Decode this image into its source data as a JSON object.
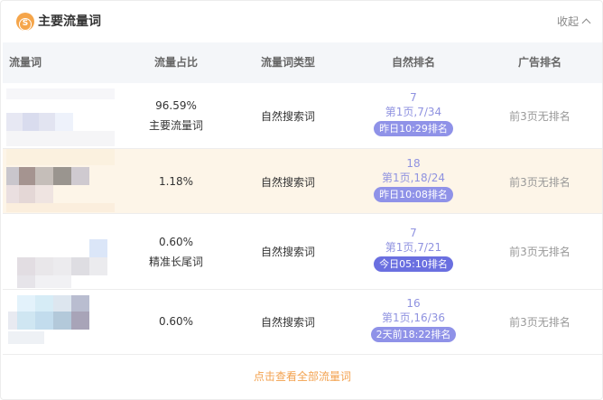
{
  "header": {
    "title": "主要流量词",
    "logo_icon": "s-coin-icon",
    "collapse_label": "收起"
  },
  "columns": [
    "流量词",
    "流量占比",
    "流量词类型",
    "自然排名",
    "广告排名"
  ],
  "rows": [
    {
      "share": "96.59%",
      "share_tag": "主要流量词",
      "type": "自然搜索词",
      "rank": "7",
      "rank_page": "第1页,7/34",
      "rank_time": "昨日10:29排名",
      "ad_rank": "前3页无排名",
      "highlight": false
    },
    {
      "share": "1.18%",
      "share_tag": "",
      "type": "自然搜索词",
      "rank": "18",
      "rank_page": "第1页,18/24",
      "rank_time": "昨日10:08排名",
      "ad_rank": "前3页无排名",
      "highlight": true
    },
    {
      "share": "0.60%",
      "share_tag": "精准长尾词",
      "type": "自然搜索词",
      "rank": "7",
      "rank_page": "第1页,7/21",
      "rank_time": "今日05:10排名",
      "ad_rank": "前3页无排名",
      "highlight": false
    },
    {
      "share": "0.60%",
      "share_tag": "",
      "type": "自然搜索词",
      "rank": "16",
      "rank_page": "第1页,16/36",
      "rank_time": "2天前18:22排名",
      "ad_rank": "前3页无排名",
      "highlight": false
    }
  ],
  "footer": {
    "view_all_label": "点击查看全部流量词"
  },
  "colors": {
    "accent_orange": "#f3a24f",
    "rank_purple": "#8f92e0",
    "highlight_row": "#fdf5e8"
  }
}
